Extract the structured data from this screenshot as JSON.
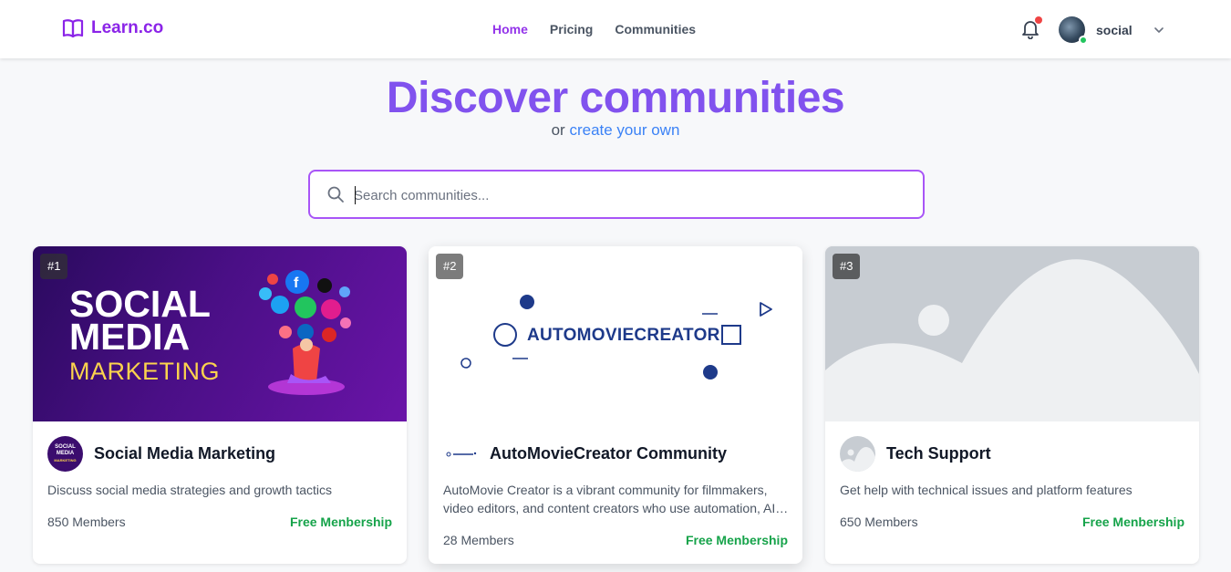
{
  "app": {
    "brand": "Learn.co",
    "nav": [
      {
        "label": "Home",
        "active": true
      },
      {
        "label": "Pricing",
        "active": false
      },
      {
        "label": "Communities",
        "active": false
      }
    ],
    "user": {
      "name": "social"
    }
  },
  "hero": {
    "title": "Discover communities",
    "subtitle_prefix": "or",
    "subtitle_link": "create your own"
  },
  "search": {
    "placeholder": "Search communities..."
  },
  "cards": [
    {
      "rank": "#1",
      "name": "Social Media Marketing",
      "description": "Discuss social media strategies and growth tactics",
      "members": "850 Members",
      "membership": "Free Menbership",
      "banner_text": [
        "SOCIAL",
        "MEDIA",
        "MARKETING"
      ],
      "thumb_text": [
        "SOCIAL",
        "MEDIA",
        "MARKETING"
      ]
    },
    {
      "rank": "#2",
      "name": "AutoMovieCreator Community",
      "description": "AutoMovie Creator is a vibrant community for filmmakers, video editors, and content creators who use automation, AI, and smart tools to create engaging videos.",
      "members": "28 Members",
      "membership": "Free Menbership",
      "banner_text": "AUTOMOVIECREATOR"
    },
    {
      "rank": "#3",
      "name": "Tech Support",
      "description": "Get help with technical issues and platform features",
      "members": "650 Members",
      "membership": "Free Menbership"
    }
  ],
  "colors": {
    "brand": "#8b24e8",
    "hero_title": "#8152ee",
    "link": "#3b82f6",
    "search_border": "#a855f7",
    "membership": "#16a34a",
    "notification": "#ef4444",
    "online": "#22c55e"
  },
  "icons": [
    "book-open-icon",
    "bell-icon",
    "chevron-down-icon",
    "search-icon",
    "image-placeholder-icon"
  ]
}
